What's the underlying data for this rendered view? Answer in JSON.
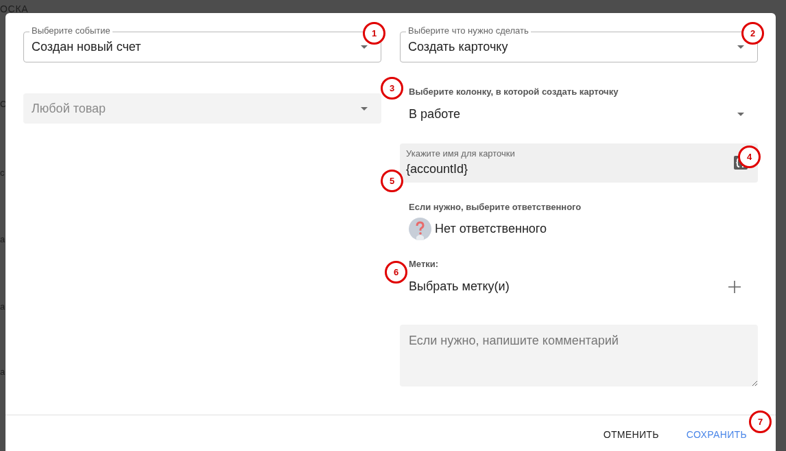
{
  "background": {
    "title": "ОСКА",
    "fragments": [
      "С",
      "с",
      "а",
      "а",
      "а"
    ]
  },
  "left": {
    "event_select": {
      "label": "Выберите событие",
      "value": "Создан новый счет"
    },
    "product_select": {
      "value": "Любой товар",
      "disabled": true
    }
  },
  "right": {
    "action_select": {
      "label": "Выберите что нужно сделать",
      "value": "Создать карточку"
    },
    "column_label": "Выберите колонку, в которой создать карточку",
    "column_select": {
      "value": "В работе"
    },
    "name_field": {
      "label": "Укажите имя для карточки",
      "value": "{accountId}"
    },
    "assignee_label": "Если нужно, выберите ответственного",
    "assignee": {
      "name": "Нет ответственного"
    },
    "tags_label": "Метки:",
    "tags_select": {
      "placeholder": "Выбрать метку(и)"
    },
    "comment": {
      "placeholder": "Если нужно, напишите комментарий"
    }
  },
  "buttons": [
    {
      "label": "ОТМЕНИТЬ",
      "kind": "secondary"
    },
    {
      "label": "СОХРАНИТЬ",
      "kind": "primary"
    }
  ],
  "annotations": [
    "1",
    "2",
    "3",
    "4",
    "5",
    "6",
    "7"
  ]
}
